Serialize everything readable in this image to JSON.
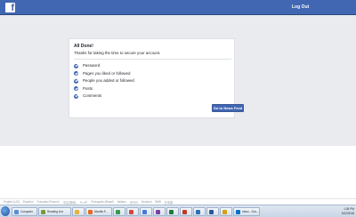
{
  "header": {
    "logo_letter": "f",
    "logout_label": "Log Out"
  },
  "card": {
    "title": "All Done!",
    "subtitle": "Thanks for taking the time to secure your account.",
    "items": [
      {
        "label": "Password"
      },
      {
        "label": "Pages you liked or followed"
      },
      {
        "label": "People you added or followed"
      },
      {
        "label": "Posts"
      },
      {
        "label": "Comments"
      }
    ],
    "button_label": "Go to News Feed"
  },
  "languages": [
    "English (US)",
    "Español",
    "Français (France)",
    "中文(简体)",
    "العربية",
    "Português (Brasil)",
    "Italiano",
    "한국어",
    "Deutsch",
    "हिन्दी",
    "日本語"
  ],
  "taskbar": {
    "items": [
      {
        "label": "Computer",
        "icon": "computer-icon",
        "color": "#5b8fd6"
      },
      {
        "label": "Reading List",
        "icon": "reading-list-icon",
        "color": "#7a9a3a"
      },
      {
        "label": "",
        "icon": "explorer-icon",
        "color": "#e8b23a"
      },
      {
        "label": "Mozilla F...",
        "icon": "firefox-icon",
        "color": "#e66b1e"
      },
      {
        "label": "",
        "icon": "app-icon",
        "color": "#3a9a4a"
      },
      {
        "label": "",
        "icon": "chrome-icon",
        "color": "#d9453a"
      },
      {
        "label": "",
        "icon": "app-icon",
        "color": "#4a7ad6"
      },
      {
        "label": "",
        "icon": "onenote-icon",
        "color": "#7b3fa0"
      },
      {
        "label": "",
        "icon": "excel-icon",
        "color": "#1f7a3a"
      },
      {
        "label": "",
        "icon": "app-icon",
        "color": "#c0392b"
      },
      {
        "label": "",
        "icon": "app-icon",
        "color": "#2c6fb8"
      },
      {
        "label": "",
        "icon": "word-icon",
        "color": "#2b579a"
      },
      {
        "label": "",
        "icon": "app-icon",
        "color": "#d4a017"
      },
      {
        "label": "Inbox - Out...",
        "icon": "outlook-icon",
        "color": "#0072c6"
      }
    ],
    "time": "1:35 PM",
    "date": "9/12/2016"
  }
}
